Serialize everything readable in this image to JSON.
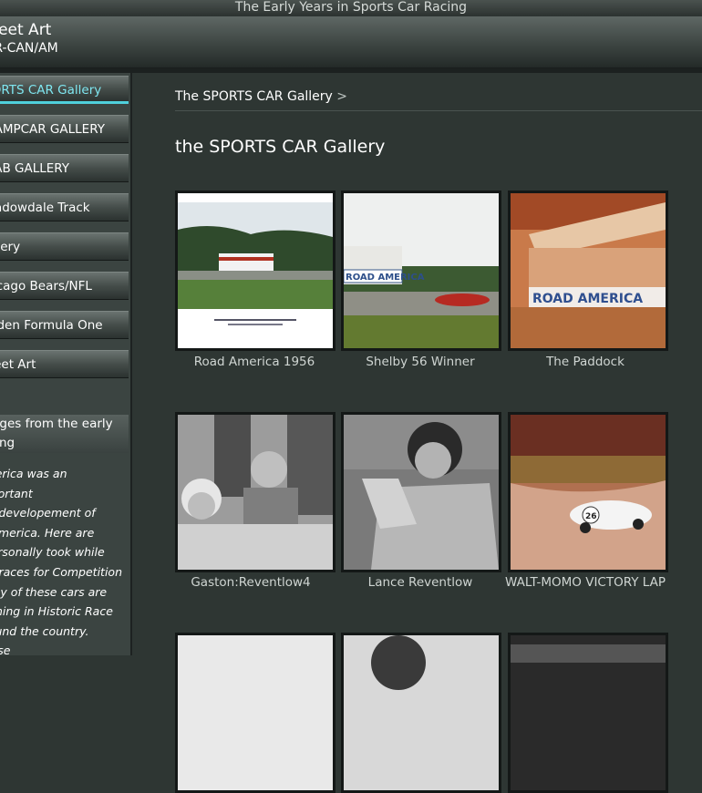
{
  "window_title": "The Early Years in Sports Car Racing",
  "header": {
    "site_title": "Street Art",
    "subtitle": "CAR-CAN/AM"
  },
  "sidebar": {
    "items": [
      {
        "label": "SPORTS CAR Gallery",
        "active": true
      },
      {
        "label": "CHAMPCAR GALLERY",
        "active": false
      },
      {
        "label": "DRAB GALLERY",
        "active": false
      },
      {
        "label": "Meadowdale Track",
        "active": false
      },
      {
        "label": "Gallery",
        "active": false
      },
      {
        "label": "Chicago Bears/NFL",
        "active": false
      },
      {
        "label": "Golden Formula One",
        "active": false
      },
      {
        "label": "Street Art",
        "active": false
      }
    ],
    "box_title": "Images from the early\nracing",
    "description": "America was an important\nthe developement of\nin America. Here are\nI personally took while\nthe races for Competition\nMany of these cars are\nrunning in Historic Race\naround the country. These\nfrom the original negatives\nprints in standard sizes."
  },
  "breadcrumb": {
    "current": "The SPORTS CAR Gallery",
    "separator": ">"
  },
  "page_title": "the SPORTS CAR Gallery",
  "gallery": [
    {
      "caption": "Road America 1956"
    },
    {
      "caption": "Shelby 56 Winner"
    },
    {
      "caption": "The Paddock"
    },
    {
      "caption": "Gaston:Reventlow4"
    },
    {
      "caption": "Lance Reventlow"
    },
    {
      "caption": "WALT-MOMO VICTORY LAP"
    }
  ],
  "photo_text": {
    "road_america_sign": "ROAD AMERICA",
    "car_number": "26"
  },
  "colors": {
    "accent": "#7fe6f0",
    "background": "#2e3633",
    "sidebar": "#3b4441"
  }
}
